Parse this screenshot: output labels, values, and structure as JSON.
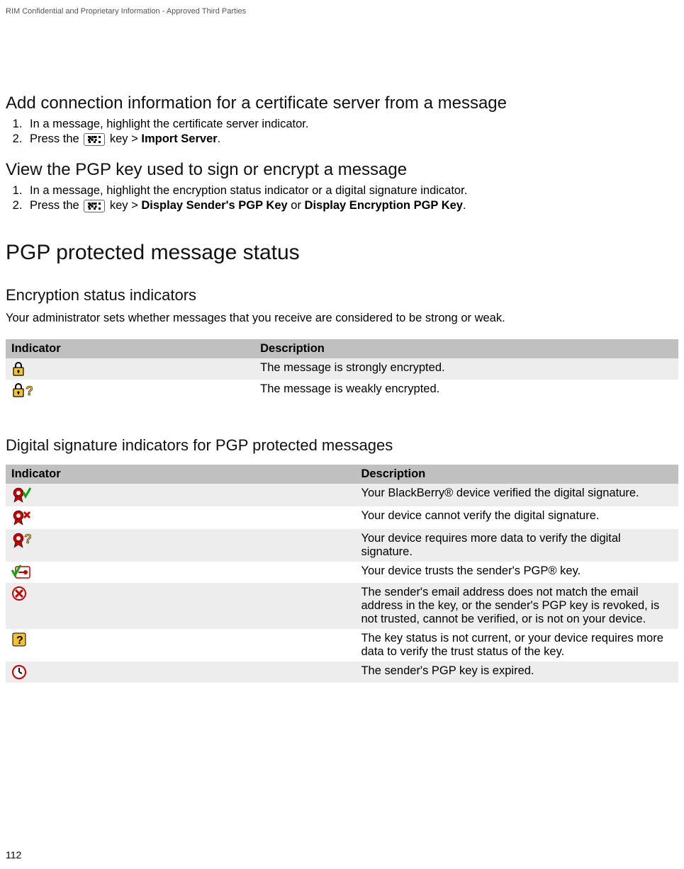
{
  "header": {
    "note": "RIM Confidential and Proprietary Information - Approved Third Parties"
  },
  "page_number": "112",
  "sections": {
    "add_conn": {
      "title": "Add connection information for a certificate server from a message",
      "step1": "In a message, highlight the certificate server indicator.",
      "step2_a": "Press the ",
      "step2_b": " key > ",
      "step2_c": "Import Server",
      "step2_d": "."
    },
    "view_pgp": {
      "title": "View the PGP key used to sign or encrypt a message",
      "step1": "In a message, highlight the encryption status indicator or a digital signature indicator.",
      "step2_a": "Press the ",
      "step2_b": " key > ",
      "step2_c": "Display Sender's PGP Key",
      "step2_d": " or ",
      "step2_e": "Display Encryption PGP Key",
      "step2_f": "."
    },
    "pgp_status": {
      "title": "PGP protected message status"
    },
    "enc_ind": {
      "title": "Encryption status indicators",
      "intro": "Your administrator sets whether messages that you receive are considered to be strong or weak.",
      "th_indicator": "Indicator",
      "th_desc": "Description",
      "row1_desc": "The message is strongly encrypted.",
      "row2_desc": "The message is weakly encrypted."
    },
    "sig_ind": {
      "title": "Digital signature indicators for PGP protected messages",
      "th_indicator": "Indicator",
      "th_desc": "Description",
      "row1_desc": "Your BlackBerry® device verified the digital signature.",
      "row2_desc": "Your device cannot verify the digital signature.",
      "row3_desc": "Your device requires more data to verify the digital signature.",
      "row4_desc": "Your device trusts the sender's PGP® key.",
      "row5_desc": "The sender's email address does not match the email address in the key, or the sender's PGP key is revoked, is not trusted, cannot be verified, or is not on your device.",
      "row6_desc": "The key status is not current, or your device requires more data to verify the trust status of the key.",
      "row7_desc": "The sender's PGP key is expired."
    }
  }
}
